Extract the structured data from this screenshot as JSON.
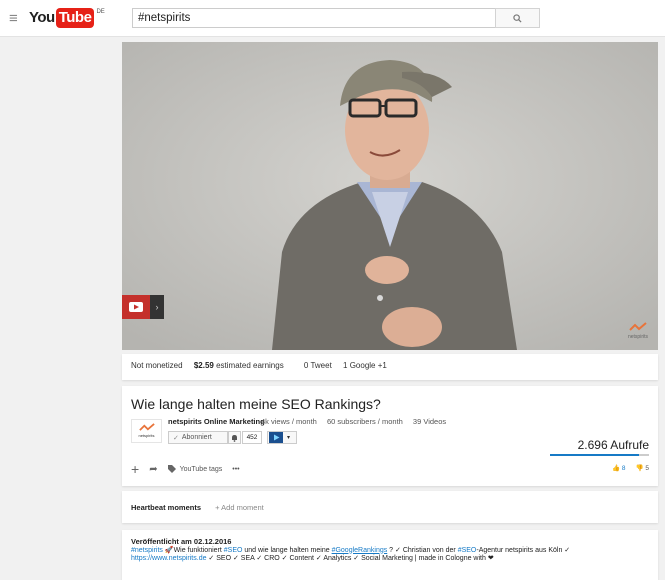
{
  "header": {
    "logo_you": "You",
    "logo_tube": "Tube",
    "logo_region": "DE",
    "search_value": "#netspirits"
  },
  "video": {
    "watermark": "netspirits"
  },
  "stats_bar": {
    "monetization": "Not monetized",
    "earnings_value": "$2.59",
    "earnings_label": "estimated earnings",
    "tweets": "0 Tweet",
    "google": "1 Google +1"
  },
  "info": {
    "title": "Wie lange halten meine SEO Rankings?",
    "channel_logo_text": "netspirits",
    "channel_name": "netspirits Online Marketing",
    "views_per_month": "4k views / month",
    "subs_per_month": "60 subscribers / month",
    "videos": "39 Videos",
    "subscribe_label": "Abonniert",
    "subscriber_count": "452",
    "views": "2.696 Aufrufe",
    "views_bar_fraction": 0.9,
    "tags_label": "YouTube tags",
    "more_label": "•••",
    "likes": "8",
    "dislikes": "5"
  },
  "heartbeat": {
    "title": "Heartbeat moments",
    "add_label": "+ Add moment"
  },
  "description": {
    "published": "Veröffentlicht am 02.12.2016",
    "tag1": "#netspirits",
    "text1": " 🚀Wie funktioniert ",
    "tag2": "#SEO",
    "text2": " und wie lange halten meine ",
    "tag3": "#GoogleRankings",
    "text3": " ? ✓ Christian von der ",
    "tag4": "#SEO",
    "text4": "-Agentur netspirits aus Köln ✓",
    "link": "https://www.netspirits.de",
    "text5": " ✓ SEO ✓ SEA ✓ CRO ✓ Content ✓ Analytics ✓ Social Marketing | made in Cologne with ❤"
  },
  "colors": {
    "yt_red": "#e62117",
    "link_blue": "#167ac6"
  }
}
